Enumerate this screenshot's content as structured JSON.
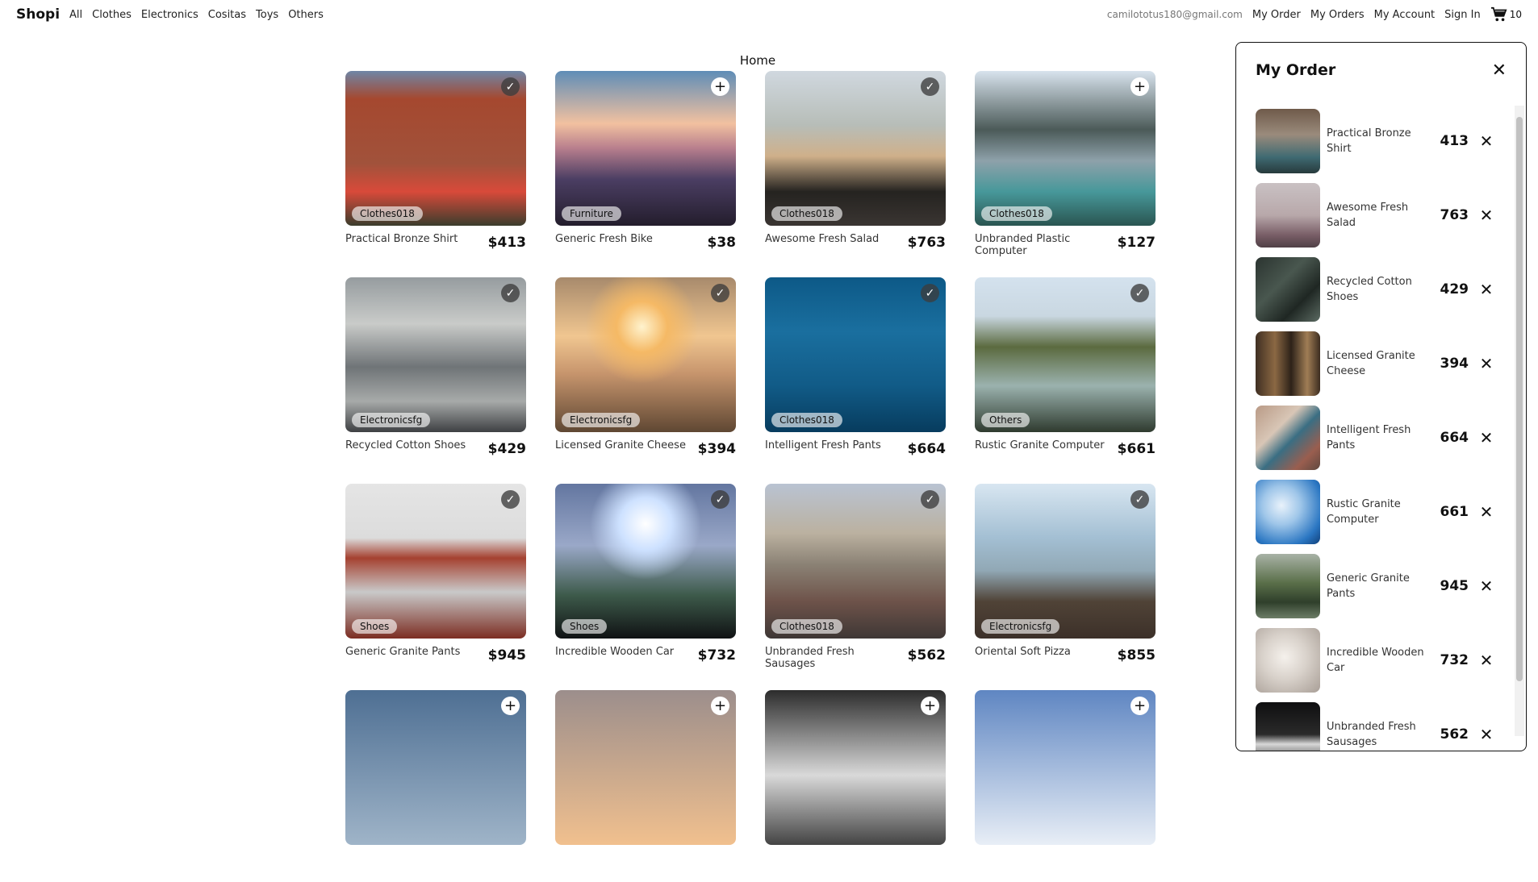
{
  "nav": {
    "brand": "Shopi",
    "categories": [
      "All",
      "Clothes",
      "Electronics",
      "Cositas",
      "Toys",
      "Others"
    ],
    "email": "camilototus180@gmail.com",
    "links": [
      "My Order",
      "My Orders",
      "My Account",
      "Sign In"
    ],
    "cart_count": "10",
    "cart_icon": "shopping-cart-icon"
  },
  "page": {
    "title": "Home"
  },
  "products": [
    {
      "name": "Practical Bronze Shirt",
      "price": "$413",
      "category": "Clothes018",
      "status": "check",
      "image": "brick-building"
    },
    {
      "name": "Generic Fresh Bike",
      "price": "$38",
      "category": "Furniture",
      "status": "add",
      "image": "sunset-clouds"
    },
    {
      "name": "Awesome Fresh Salad",
      "price": "$763",
      "category": "Clothes018",
      "status": "check",
      "image": "beach-rocks"
    },
    {
      "name": "Unbranded Plastic Computer",
      "price": "$127",
      "category": "Clothes018",
      "status": "add",
      "image": "mountain-lake"
    },
    {
      "name": "Recycled Cotton Shoes",
      "price": "$429",
      "category": "Electronicsfg",
      "status": "check",
      "image": "old-building"
    },
    {
      "name": "Licensed Granite Cheese",
      "price": "$394",
      "category": "Electronicsfg",
      "status": "check",
      "image": "beach-sunset"
    },
    {
      "name": "Intelligent Fresh Pants",
      "price": "$664",
      "category": "Clothes018",
      "status": "check",
      "image": "ocean-blue"
    },
    {
      "name": "Rustic Granite Computer",
      "price": "$661",
      "category": "Others",
      "status": "check",
      "image": "pier-lake"
    },
    {
      "name": "Generic Granite Pants",
      "price": "$945",
      "category": "Shoes",
      "status": "check",
      "image": "golden-gate"
    },
    {
      "name": "Incredible Wooden Car",
      "price": "$732",
      "category": "Shoes",
      "status": "check",
      "image": "concert-lights"
    },
    {
      "name": "Unbranded Fresh Sausages",
      "price": "$562",
      "category": "Clothes018",
      "status": "check",
      "image": "railroad"
    },
    {
      "name": "Oriental Soft Pizza",
      "price": "$855",
      "category": "Electronicsfg",
      "status": "check",
      "image": "bay-silhouette"
    },
    {
      "name": "",
      "price": "",
      "category": "",
      "status": "add",
      "image": "sky-clouds"
    },
    {
      "name": "",
      "price": "",
      "category": "",
      "status": "add",
      "image": "sunrise"
    },
    {
      "name": "",
      "price": "",
      "category": "",
      "status": "add",
      "image": "waterfall"
    },
    {
      "name": "",
      "price": "",
      "category": "",
      "status": "add",
      "image": "bright-clouds"
    }
  ],
  "order": {
    "title": "My Order",
    "close_icon": "close-icon",
    "items": [
      {
        "name": "Practical Bronze Shirt",
        "price": "413",
        "image": "city-street"
      },
      {
        "name": "Awesome Fresh Salad",
        "price": "763",
        "image": "misty-beach"
      },
      {
        "name": "Recycled Cotton Shoes",
        "price": "429",
        "image": "dark-foliage"
      },
      {
        "name": "Licensed Granite Cheese",
        "price": "394",
        "image": "bookshelf"
      },
      {
        "name": "Intelligent Fresh Pants",
        "price": "664",
        "image": "desk-items"
      },
      {
        "name": "Rustic Granite Computer",
        "price": "661",
        "image": "blue-drops"
      },
      {
        "name": "Generic Granite Pants",
        "price": "945",
        "image": "green-plants"
      },
      {
        "name": "Incredible Wooden Car",
        "price": "732",
        "image": "foggy-light"
      },
      {
        "name": "Unbranded Fresh Sausages",
        "price": "562",
        "image": "dark-night"
      }
    ]
  }
}
